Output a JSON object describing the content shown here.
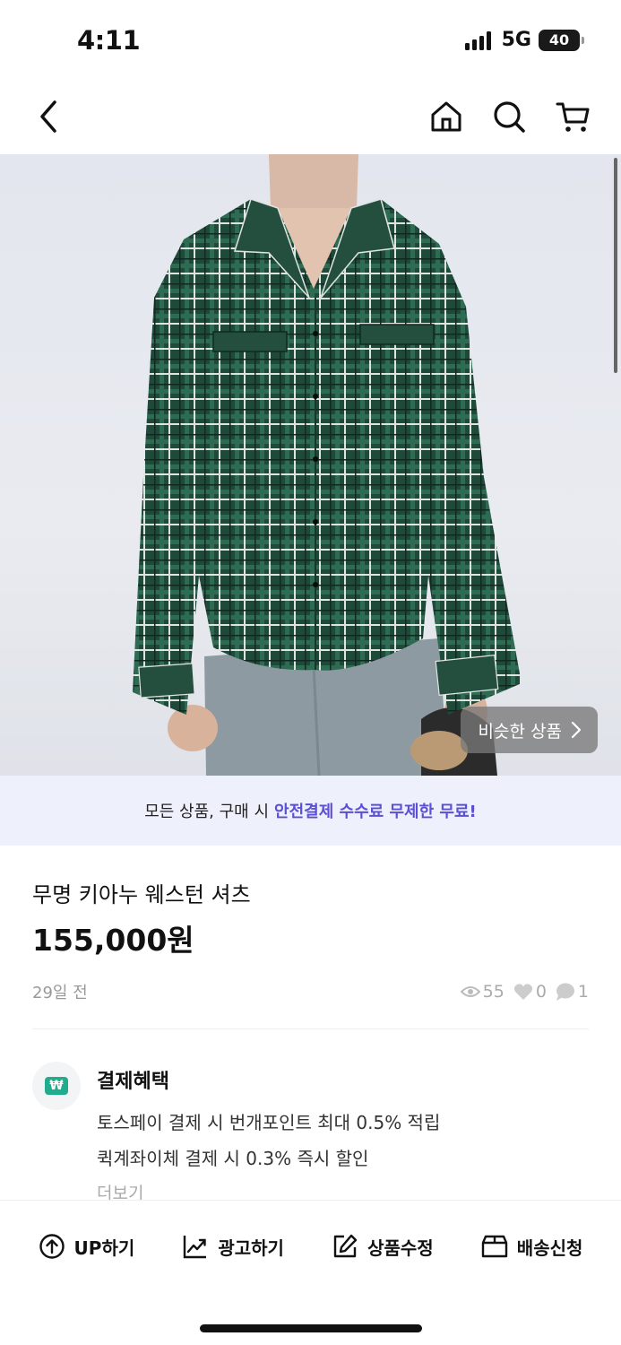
{
  "status_bar": {
    "time": "4:11",
    "network": "5G",
    "battery": "40"
  },
  "nav": {
    "back_icon": "chevron-left-icon",
    "home_icon": "home-icon",
    "search_icon": "search-icon",
    "cart_icon": "cart-icon"
  },
  "hero": {
    "image_alt": "green plaid western shirt on model",
    "similar_button": "비슷한 상품"
  },
  "promo": {
    "text": "모든 상품, 구매 시",
    "highlight": "안전결제 수수료 무제한 무료!"
  },
  "product": {
    "title": "무명 키아누 웨스턴 셔츠",
    "price": "155,000원",
    "posted": "29일 전",
    "views": "55",
    "likes": "0",
    "chats": "1"
  },
  "benefit": {
    "title": "결제혜택",
    "lines": [
      "토스페이 결제 시 번개포인트 최대 0.5% 적립",
      "퀵계좌이체 결제 시 0.3% 즉시 할인"
    ],
    "more": "더보기"
  },
  "actions": [
    {
      "label": "UP하기",
      "icon": "arrow-up-circle-icon"
    },
    {
      "label": "광고하기",
      "icon": "trend-chart-icon"
    },
    {
      "label": "상품수정",
      "icon": "edit-icon"
    },
    {
      "label": "배송신청",
      "icon": "box-icon"
    }
  ],
  "colors": {
    "accent": "#5b4fd6",
    "promo_bg": "#eef0fb",
    "benefit_green": "#1fad8e"
  }
}
